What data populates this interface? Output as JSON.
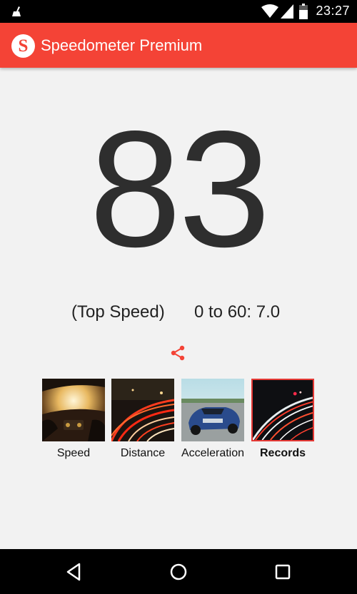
{
  "status_bar": {
    "time": "23:27",
    "icons": [
      "cleaner-icon",
      "wifi-icon",
      "signal-icon",
      "battery-icon"
    ]
  },
  "app_bar": {
    "logo_letter": "S",
    "title": "Speedometer Premium",
    "color": "#f44336"
  },
  "speed": {
    "value": "83"
  },
  "stats": {
    "top_speed_label": "(Top Speed)",
    "acceleration_text": "0 to 60: 7.0"
  },
  "share": {
    "icon": "share-icon",
    "color": "#f44336"
  },
  "tabs": [
    {
      "label": "Speed",
      "selected": false,
      "icon": "car-dashboard-thumbnail"
    },
    {
      "label": "Distance",
      "selected": false,
      "icon": "night-highway-thumbnail"
    },
    {
      "label": "Acceleration",
      "selected": false,
      "icon": "sports-car-thumbnail"
    },
    {
      "label": "Records",
      "selected": true,
      "icon": "light-trails-thumbnail"
    }
  ],
  "nav_bar": {
    "buttons": [
      "back-icon",
      "home-icon",
      "recents-icon"
    ]
  }
}
